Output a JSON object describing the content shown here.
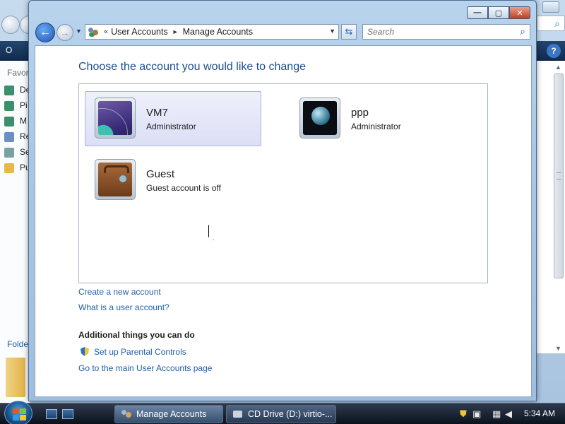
{
  "window": {
    "title": "Manage Accounts",
    "controls": {
      "minimize": "—",
      "maximize": "▢",
      "close": "✕"
    }
  },
  "address_bar": {
    "prefix": "«",
    "crumbs": [
      "User Accounts",
      "Manage Accounts"
    ],
    "separator": "►"
  },
  "search": {
    "placeholder": "Search"
  },
  "main": {
    "heading": "Choose the account you would like to change",
    "accounts": [
      {
        "name": "VM7",
        "role": "Administrator",
        "selected": true
      },
      {
        "name": "ppp",
        "role": "Administrator",
        "selected": false
      },
      {
        "name": "Guest",
        "role": "Guest account is off",
        "selected": false
      }
    ],
    "links": {
      "create": "Create a new account",
      "what_is": "What is a user account?"
    },
    "additional": {
      "heading": "Additional things you can do",
      "parental": "Set up Parental Controls",
      "main_page": "Go to the main User Accounts page"
    }
  },
  "background_window": {
    "toolbar_label": "O",
    "help": "?",
    "favorites_label": "Favor",
    "sidebar_items": [
      "De",
      "Pi",
      "M",
      "Re",
      "Se",
      "Pu"
    ],
    "folders_label": "Folde"
  },
  "taskbar": {
    "tasks": [
      {
        "label": "Manage Accounts",
        "active": true
      },
      {
        "label": "CD Drive (D:) virtio-...",
        "active": false
      }
    ],
    "clock": "5:34 AM"
  },
  "colors": {
    "link": "#1e5fa8",
    "heading": "#1e4e8c",
    "selection": "#dcdff6"
  }
}
